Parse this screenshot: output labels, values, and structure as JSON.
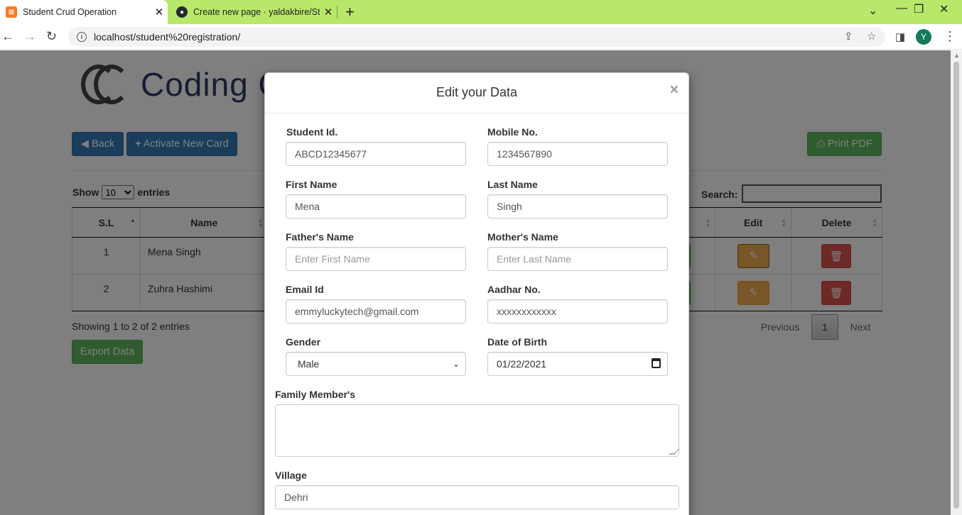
{
  "browser": {
    "tabs": [
      {
        "title": "Student Crud Operation",
        "active": true
      },
      {
        "title": "Create new page · yaldakbire/Stu",
        "active": false
      }
    ],
    "url": "localhost/student%20registration/",
    "profile_initial": "Y"
  },
  "page": {
    "logo_text": "Coding Cu",
    "back_label": "Back",
    "activate_label": "Activate New Card",
    "print_label": "Print PDF",
    "show_label": "Show",
    "entries_value": "10",
    "entries_label": "entries",
    "search_label": "Search:",
    "table": {
      "headers": [
        "S.L",
        "Name",
        "",
        "Edit",
        "Delete"
      ],
      "rows": [
        {
          "sl": "1",
          "name": "Mena Singh"
        },
        {
          "sl": "2",
          "name": "Zuhra Hashimi"
        }
      ]
    },
    "info": "Showing 1 to 2 of 2 entries",
    "pagination": {
      "previous": "Previous",
      "current": "1",
      "next": "Next"
    },
    "export_label": "Export Data"
  },
  "modal": {
    "title": "Edit your Data",
    "close": "×",
    "fields": {
      "student_id": {
        "label": "Student Id.",
        "value": "ABCD12345677"
      },
      "mobile": {
        "label": "Mobile No.",
        "value": "1234567890"
      },
      "first_name": {
        "label": "First Name",
        "value": "Mena"
      },
      "last_name": {
        "label": "Last Name",
        "value": "Singh"
      },
      "father_name": {
        "label": "Father's Name",
        "placeholder": "Enter First Name"
      },
      "mother_name": {
        "label": "Mother's Name",
        "placeholder": "Enter Last Name"
      },
      "email": {
        "label": "Email Id",
        "value": "emmyluckytech@gmail.com"
      },
      "aadhar": {
        "label": "Aadhar No.",
        "value": "xxxxxxxxxxxx"
      },
      "gender": {
        "label": "Gender",
        "value": "Male"
      },
      "dob": {
        "label": "Date of Birth",
        "value": "01/22/2021"
      },
      "family": {
        "label": "Family Member's",
        "value": ""
      },
      "village": {
        "label": "Village",
        "value": "Dehri"
      }
    }
  },
  "colors": {
    "tab_strip": "#b8e86a",
    "primary": "#337ab7",
    "success": "#5cb85c",
    "warning": "#f0ad4e",
    "danger": "#d9534f"
  }
}
